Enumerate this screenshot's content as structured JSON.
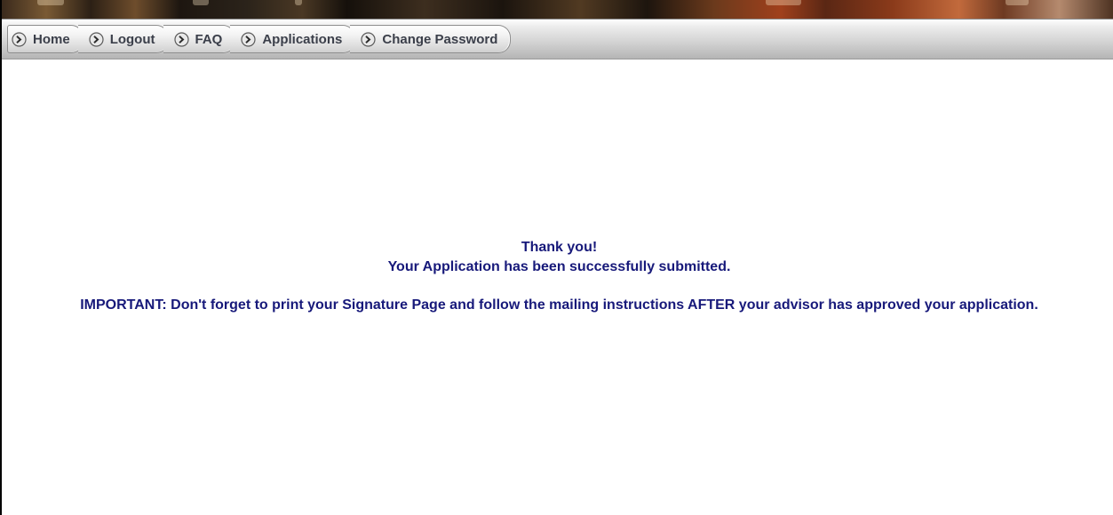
{
  "nav": {
    "items": [
      {
        "label": "Home",
        "icon": "chevron-right-icon"
      },
      {
        "label": "Logout",
        "icon": "chevron-right-icon"
      },
      {
        "label": "FAQ",
        "icon": "chevron-right-icon"
      },
      {
        "label": "Applications",
        "icon": "chevron-right-icon"
      },
      {
        "label": "Change Password",
        "icon": "chevron-right-icon"
      }
    ]
  },
  "message": {
    "thank_you": "Thank you!",
    "submitted": "Your Application has been successfully submitted.",
    "important": "IMPORTANT: Don't forget to print your Signature Page and follow the mailing instructions AFTER your advisor has approved your application."
  },
  "colors": {
    "message_text": "#17197a",
    "nav_text": "#3b3f4a"
  }
}
